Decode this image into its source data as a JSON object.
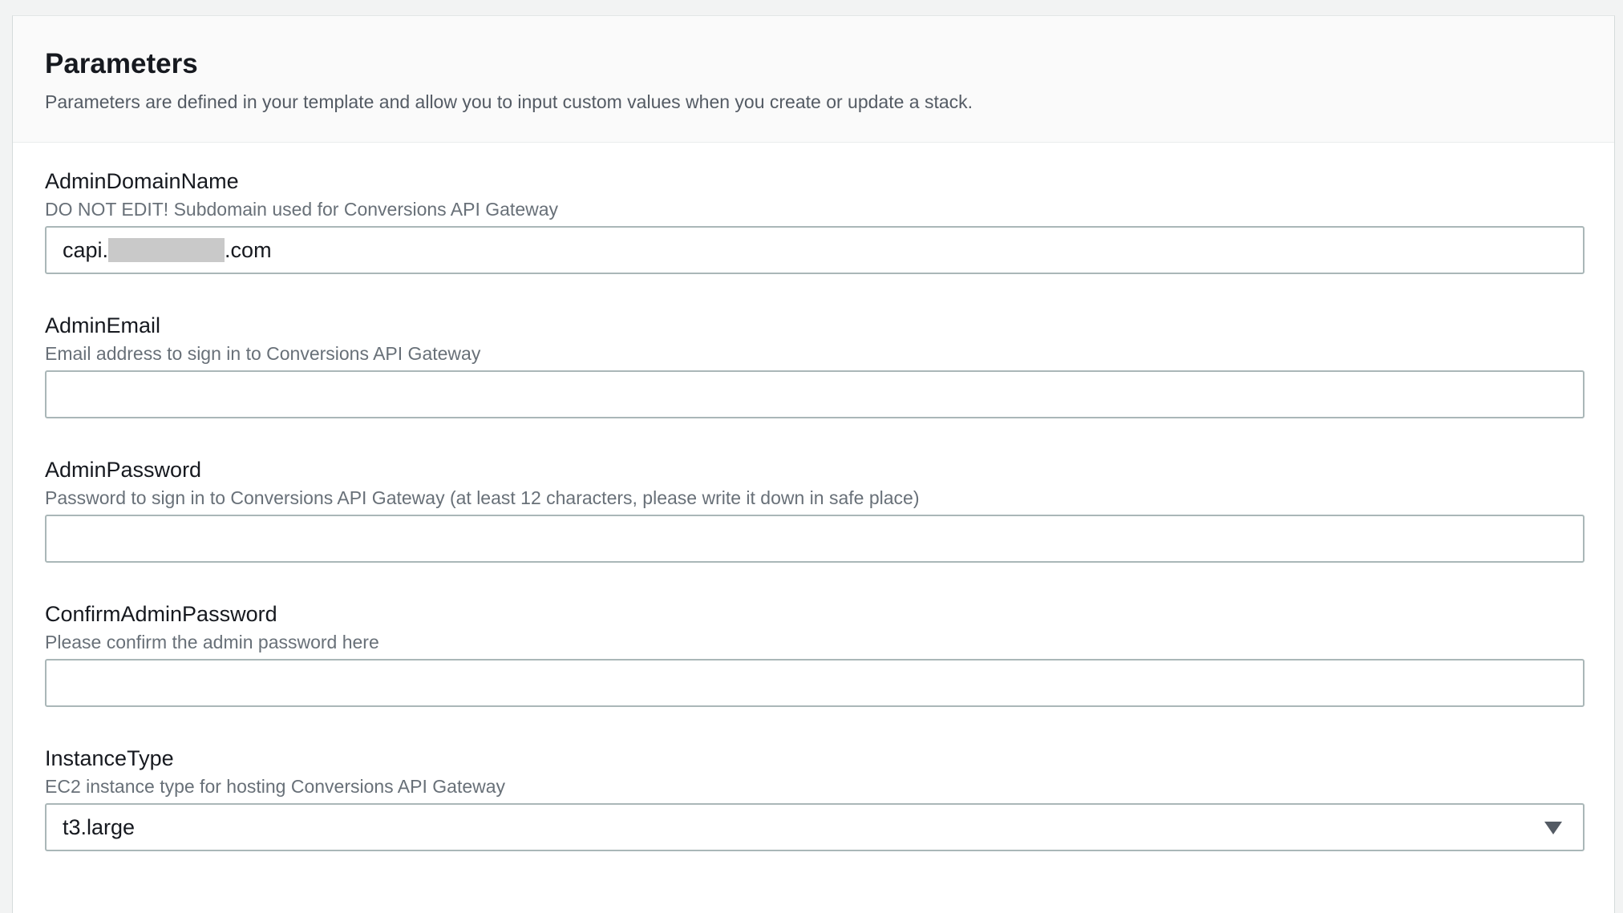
{
  "panel": {
    "title": "Parameters",
    "description": "Parameters are defined in your template and allow you to input custom values when you create or update a stack."
  },
  "fields": {
    "admin_domain": {
      "label": "AdminDomainName",
      "description": "DO NOT EDIT! Subdomain used for Conversions API Gateway",
      "value_prefix": "capi.",
      "value_suffix": ".com"
    },
    "admin_email": {
      "label": "AdminEmail",
      "description": "Email address to sign in to Conversions API Gateway",
      "value": ""
    },
    "admin_password": {
      "label": "AdminPassword",
      "description": "Password to sign in to Conversions API Gateway (at least 12 characters, please write it down in safe place)",
      "value": ""
    },
    "confirm_admin_password": {
      "label": "ConfirmAdminPassword",
      "description": "Please confirm the admin password here",
      "value": ""
    },
    "instance_type": {
      "label": "InstanceType",
      "description": "EC2 instance type for hosting Conversions API Gateway",
      "selected": "t3.large"
    }
  },
  "icons": {
    "select_caret": "caret-down-icon"
  }
}
